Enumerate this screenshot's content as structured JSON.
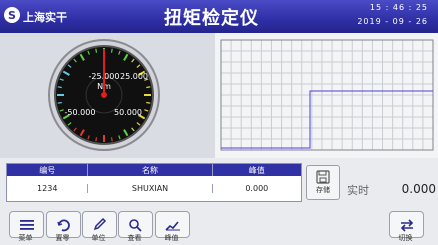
{
  "header": {
    "brand": "上海实干",
    "title": "扭矩检定仪",
    "time": "15 : 46 : 25",
    "date": "2019 - 09 - 26"
  },
  "gauge": {
    "unit": "Nm",
    "value": 0.0,
    "labels": [
      "-25.000",
      "25.000",
      "-50.000",
      "50.000"
    ],
    "colors": {
      "yellow": "#e8d83a",
      "red": "#e23a2a",
      "green": "#5ed045",
      "cyan": "#65c9e0"
    }
  },
  "table": {
    "headers": [
      "编号",
      "名称",
      "峰值"
    ],
    "row": [
      "1234",
      "SHUXIAN",
      "0.000"
    ]
  },
  "store": {
    "label": "存储"
  },
  "mode": {
    "label": "实时"
  },
  "reading": "0.000",
  "buttons": [
    {
      "label": "菜单",
      "icon": "menu-icon"
    },
    {
      "label": "置零",
      "icon": "refresh-icon"
    },
    {
      "label": "单位",
      "icon": "pencil-icon"
    },
    {
      "label": "查看",
      "icon": "search-icon"
    },
    {
      "label": "峰值",
      "icon": "line-chart-icon"
    },
    {
      "label": "切换",
      "icon": "swap-icon"
    }
  ],
  "colors": {
    "header": "#2f2fa6",
    "table_header": "#3131a6",
    "trace": "#4b41d8"
  }
}
